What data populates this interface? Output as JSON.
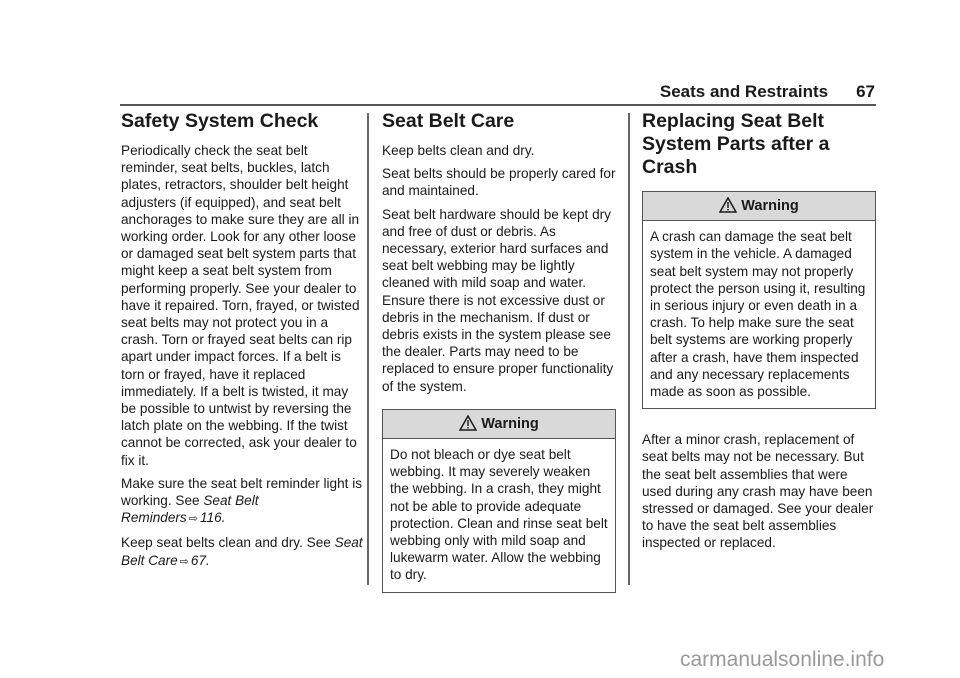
{
  "header": {
    "section": "Seats and Restraints",
    "page": "67"
  },
  "col1": {
    "title": "Safety System Check",
    "p1": "Periodically check the seat belt reminder, seat belts, buckles, latch plates, retractors, shoulder belt height adjusters (if equipped), and seat belt anchorages to make sure they are all in working order. Look for any other loose or damaged seat belt system parts that might keep a seat belt system from performing properly. See your dealer to have it repaired. Torn, frayed, or twisted seat belts may not protect you in a crash. Torn or frayed seat belts can rip apart under impact forces. If a belt is torn or frayed, have it replaced immediately. If a belt is twisted, it may be possible to untwist by reversing the latch plate on the webbing. If the twist cannot be corrected, ask your dealer to fix it.",
    "p2_text": "Make sure the seat belt reminder light is working. See ",
    "p2_link": "Seat Belt Reminders",
    "p2_page": "116",
    "p3_text": "Keep seat belts clean and dry. See ",
    "p3_link": "Seat Belt Care",
    "p3_page": "67",
    "ref_arrow": "⇨"
  },
  "col2": {
    "title": "Seat Belt Care",
    "p1": "Keep belts clean and dry.",
    "p2": "Seat belts should be properly cared for and maintained.",
    "p3": "Seat belt hardware should be kept dry and free of dust or debris. As necessary, exterior hard surfaces and seat belt webbing may be lightly cleaned with mild soap and water. Ensure there is not excessive dust or debris in the mechanism. If dust or debris exists in the system please see the dealer. Parts may need to be replaced to ensure proper functionality of the system.",
    "warning": {
      "label": "Warning",
      "body": "Do not bleach or dye seat belt webbing. It may severely weaken the webbing. In a crash, they might not be able to provide adequate protection. Clean and rinse seat belt webbing only with mild soap and lukewarm water. Allow the webbing to dry."
    }
  },
  "col3": {
    "title": "Replacing Seat Belt System Parts after a Crash",
    "warning": {
      "label": "Warning",
      "body": "A crash can damage the seat belt system in the vehicle. A damaged seat belt system may not properly protect the person using it, resulting in serious injury or even death in a crash. To help make sure the seat belt systems are working properly after a crash, have them inspected and any necessary replacements made as soon as possible."
    },
    "p1": "After a minor crash, replacement of seat belts may not be necessary. But the seat belt assemblies that were used during any crash may have been stressed or damaged. See your dealer to have the seat belt assemblies inspected or replaced."
  },
  "footer": {
    "watermark": "carmanualsonline.info"
  },
  "colors": {
    "warning_header_bg": "#d9d9d9",
    "rule": "#555555",
    "watermark": "#999999"
  }
}
